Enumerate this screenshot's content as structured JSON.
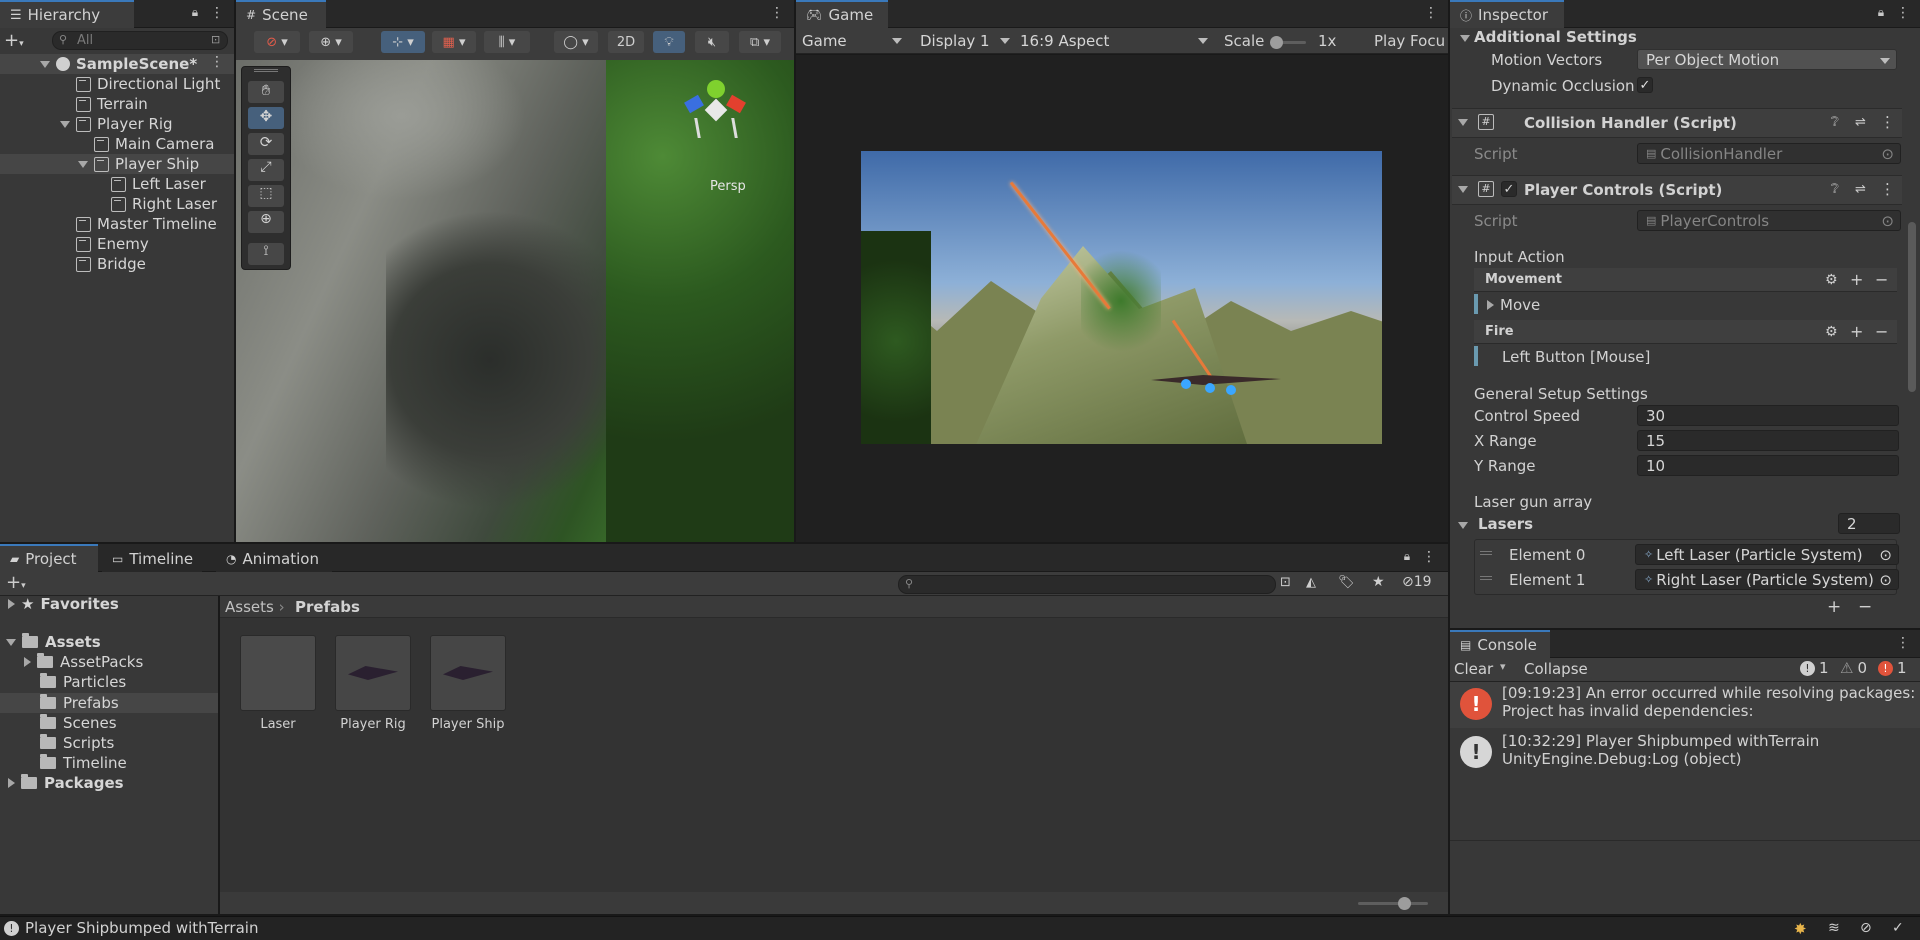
{
  "hierarchy": {
    "tab_label": "Hierarchy",
    "search_placeholder": "All",
    "items": [
      {
        "label": "SampleScene*"
      },
      {
        "label": "Directional Light"
      },
      {
        "label": "Terrain"
      },
      {
        "label": "Player Rig"
      },
      {
        "label": "Main Camera"
      },
      {
        "label": "Player Ship"
      },
      {
        "label": "Left Laser"
      },
      {
        "label": "Right Laser"
      },
      {
        "label": "Master Timeline"
      },
      {
        "label": "Enemy"
      },
      {
        "label": "Bridge"
      }
    ]
  },
  "scene": {
    "tab_label": "Scene",
    "toolbar": {
      "mode_2d": "2D"
    },
    "gizmo_label": "Persp"
  },
  "game": {
    "tab_label": "Game",
    "view_select": "Game",
    "display_select": "Display 1",
    "aspect_select": "16:9 Aspect",
    "scale_label": "Scale",
    "scale_value": "1x",
    "play_focus": "Play Focu"
  },
  "inspector": {
    "tab_label": "Inspector",
    "additional_settings": "Additional Settings",
    "motion_vectors_label": "Motion Vectors",
    "motion_vectors_value": "Per Object Motion",
    "dynamic_occlusion_label": "Dynamic Occlusion",
    "collision_handler": {
      "title": "Collision Handler (Script)",
      "script_label": "Script",
      "script_value": "CollisionHandler"
    },
    "player_controls": {
      "title": "Player Controls (Script)",
      "script_label": "Script",
      "script_value": "PlayerControls",
      "input_action": "Input Action",
      "movement_label": "Movement",
      "move_label": "Move",
      "fire_label": "Fire",
      "fire_binding": "Left Button [Mouse]",
      "general_setup": "General Setup Settings",
      "control_speed_label": "Control Speed",
      "control_speed_value": "30",
      "x_range_label": "X Range",
      "x_range_value": "15",
      "y_range_label": "Y Range",
      "y_range_value": "10",
      "laser_gun_array": "Laser gun array",
      "lasers_label": "Lasers",
      "lasers_count": "2",
      "element0_label": "Element 0",
      "element0_value": "Left Laser (Particle System)",
      "element1_label": "Element 1",
      "element1_value": "Right Laser (Particle System)"
    }
  },
  "project": {
    "tabs": [
      "Project",
      "Timeline",
      "Animation"
    ],
    "hidden_count": "19",
    "favorites": "Favorites",
    "assets": "Assets",
    "folders": [
      "AssetPacks",
      "Particles",
      "Prefabs",
      "Scenes",
      "Scripts",
      "Timeline"
    ],
    "packages": "Packages",
    "breadcrumb": {
      "root": "Assets",
      "current": "Prefabs"
    },
    "prefabs": [
      {
        "label": "Laser"
      },
      {
        "label": "Player Rig"
      },
      {
        "label": "Player Ship"
      }
    ]
  },
  "console": {
    "tab_label": "Console",
    "clear": "Clear",
    "collapse": "Collapse",
    "log_count": "1",
    "warn_count": "0",
    "error_count": "1",
    "entries": [
      {
        "line1": "[09:19:23] An error occurred while resolving packages:",
        "line2": "Project has invalid dependencies:"
      },
      {
        "line1": "[10:32:29] Player Shipbumped withTerrain",
        "line2": "UnityEngine.Debug:Log (object)"
      }
    ]
  },
  "status_bar": {
    "message": "Player Shipbumped withTerrain"
  }
}
